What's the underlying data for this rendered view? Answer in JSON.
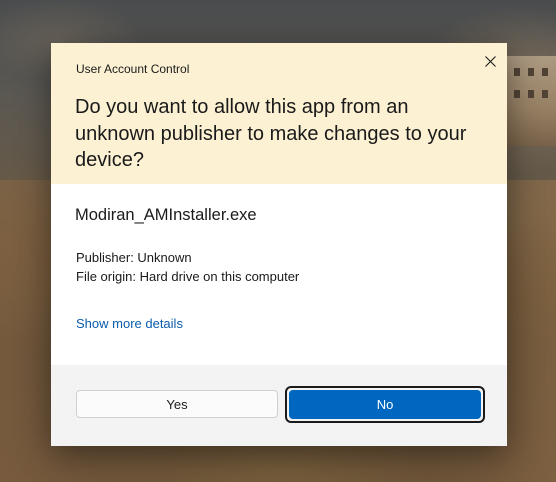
{
  "dialog": {
    "caption": "User Account Control",
    "question": "Do you want to allow this app from an unknown publisher to make changes to your device?",
    "app_name": "Modiran_AMInstaller.exe",
    "publisher": "Publisher: Unknown",
    "file_origin": "File origin: Hard drive on this computer",
    "details_link": "Show more details",
    "yes_label": "Yes",
    "no_label": "No"
  },
  "icons": {
    "close": "close-icon"
  },
  "colors": {
    "header_bg": "#fcf1d3",
    "primary_button": "#0067c0",
    "link": "#0b5cad",
    "footer_bg": "#f3f3f3"
  }
}
